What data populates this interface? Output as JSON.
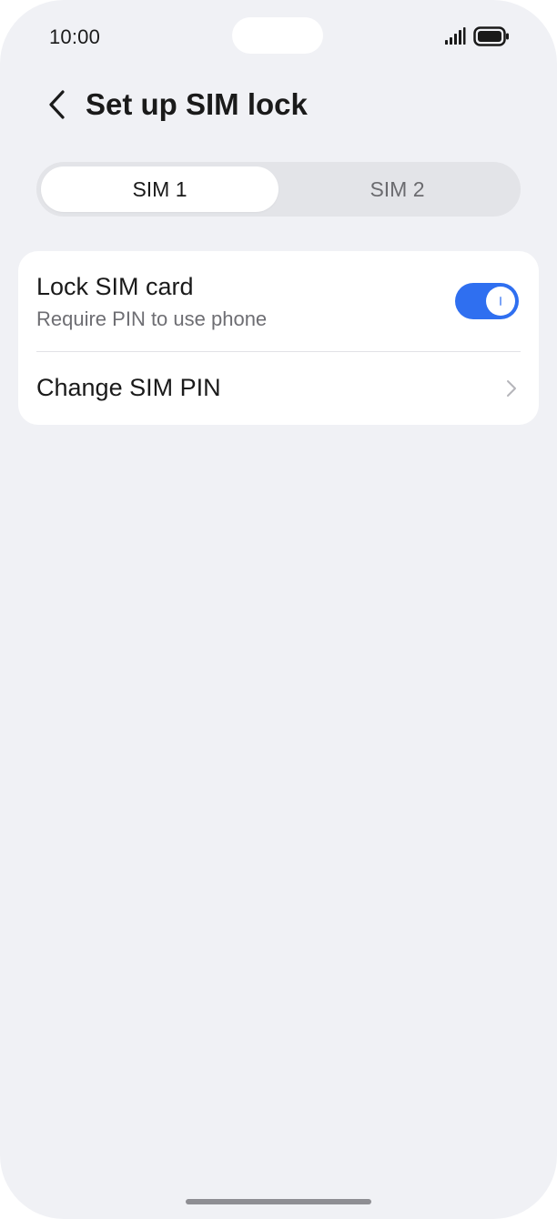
{
  "status_bar": {
    "time": "10:00",
    "signal_icon": "signal-bars-icon",
    "battery_icon": "battery-full-icon"
  },
  "header": {
    "back_icon": "chevron-left-icon",
    "title": "Set up SIM lock"
  },
  "tabs": [
    {
      "label": "SIM 1",
      "active": true
    },
    {
      "label": "SIM 2",
      "active": false
    }
  ],
  "settings": {
    "lock_sim": {
      "title": "Lock SIM card",
      "subtitle": "Require PIN to use phone",
      "enabled": true
    },
    "change_pin": {
      "title": "Change SIM PIN",
      "icon": "chevron-right-icon"
    }
  },
  "colors": {
    "accent": "#2f6ff0",
    "background": "#f0f1f5",
    "card": "#ffffff"
  }
}
